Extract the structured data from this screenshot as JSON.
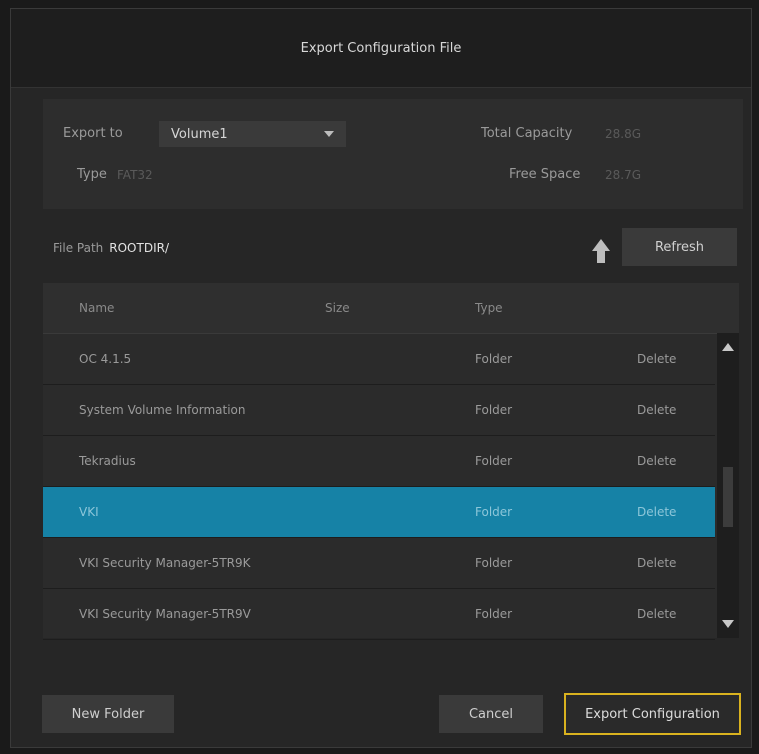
{
  "dialog": {
    "title": "Export Configuration File"
  },
  "info": {
    "export_to_label": "Export to",
    "volume_selected": "Volume1",
    "type_label": "Type",
    "type_value": "FAT32",
    "total_capacity_label": "Total Capacity",
    "total_capacity_value": "28.8G",
    "free_space_label": "Free Space",
    "free_space_value": "28.7G"
  },
  "path": {
    "label": "File Path",
    "value": "ROOTDIR/",
    "refresh_label": "Refresh"
  },
  "table": {
    "columns": [
      "Name",
      "Size",
      "Type"
    ],
    "rows": [
      {
        "name": "OC 4.1.5",
        "size": "",
        "type": "Folder",
        "action": "Delete"
      },
      {
        "name": "System Volume Information",
        "size": "",
        "type": "Folder",
        "action": "Delete"
      },
      {
        "name": "Tekradius",
        "size": "",
        "type": "Folder",
        "action": "Delete"
      },
      {
        "name": "VKI",
        "size": "",
        "type": "Folder",
        "action": "Delete"
      },
      {
        "name": "VKI Security Manager-5TR9K",
        "size": "",
        "type": "Folder",
        "action": "Delete"
      },
      {
        "name": "VKI Security Manager-5TR9V",
        "size": "",
        "type": "Folder",
        "action": "Delete"
      }
    ]
  },
  "footer": {
    "new_folder_label": "New Folder",
    "cancel_label": "Cancel",
    "export_label": "Export Configuration"
  },
  "colors": {
    "selected_row": "#1682a6",
    "primary_border": "#d9b21f"
  }
}
